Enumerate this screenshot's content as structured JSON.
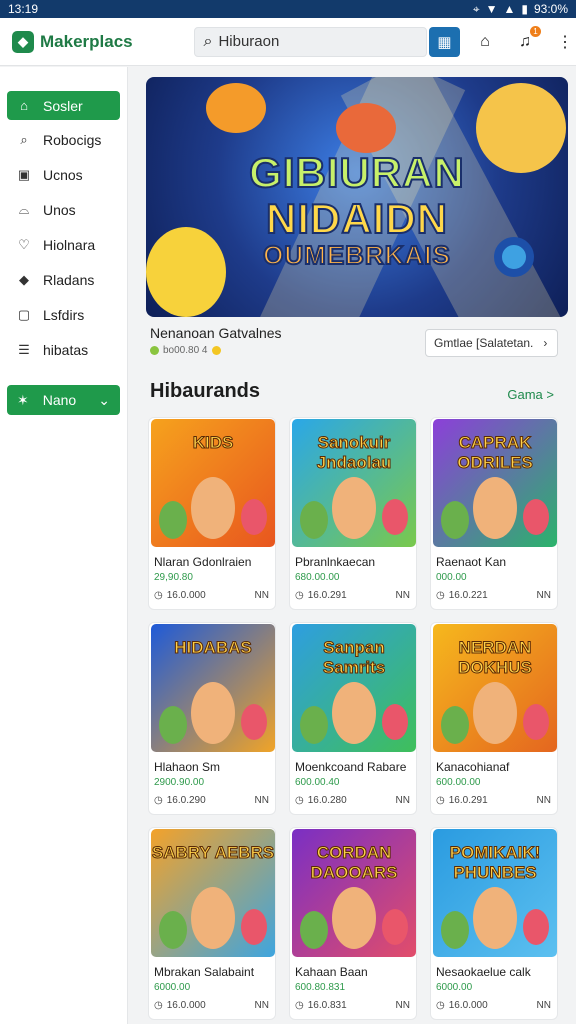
{
  "status": {
    "time": "13:19",
    "battery": "93:0%"
  },
  "app": {
    "name": "Makerplacs"
  },
  "search": {
    "value": "Hiburaon"
  },
  "notifications": {
    "count": "1"
  },
  "sidebar": {
    "items": [
      {
        "label": "Sosler",
        "icon": "home-icon"
      },
      {
        "label": "Robocigs",
        "icon": "search-icon"
      },
      {
        "label": "Ucnos",
        "icon": "image-icon"
      },
      {
        "label": "Unos",
        "icon": "bag-icon"
      },
      {
        "label": "Hiolnara",
        "icon": "heart-icon"
      },
      {
        "label": "Rladans",
        "icon": "gem-icon"
      },
      {
        "label": "Lsfdirs",
        "icon": "frame-icon"
      },
      {
        "label": "hibatas",
        "icon": "list-icon"
      }
    ],
    "cta": {
      "label": "Nano"
    }
  },
  "hero": {
    "line1": "GIBIURAN",
    "line2": "NIDAIDN",
    "line3": "OUMEBRKAIS",
    "name": "Nenanoan Gatvalnes",
    "sub": "bo00.80 4"
  },
  "select_button": {
    "label": "Gmtlae  [Salatetan."
  },
  "section": {
    "title": "Hibaurands",
    "see_all": "Gama >"
  },
  "games": [
    {
      "title": "Nlaran Gdonlraien",
      "price": "29,90.80",
      "time": "16.0.000",
      "tag": "NN",
      "art": "KIDS",
      "bg1": "#f6a21d",
      "bg2": "#e8561f"
    },
    {
      "title": "Pbranlnkaecan",
      "price": "680.00.00",
      "time": "16.0.291",
      "tag": "NN",
      "art": "Sanokuir Jndaolau",
      "bg1": "#2aa7e8",
      "bg2": "#7ac94c"
    },
    {
      "title": "Raenaot Kan",
      "price": "000.00",
      "time": "16.0.221",
      "tag": "NN",
      "art": "CAPRAK ODRILES",
      "bg1": "#8c3fd9",
      "bg2": "#2bb36b"
    },
    {
      "title": "Hlahaon Sm",
      "price": "2900.90.00",
      "time": "16.0.290",
      "tag": "NN",
      "art": "HIDABAS",
      "bg1": "#1e5ad8",
      "bg2": "#f0a428"
    },
    {
      "title": "Moenkcoand Rabare",
      "price": "600.00.40",
      "time": "16.0.280",
      "tag": "NN",
      "art": "Sanpan Samrits",
      "bg1": "#2e9ee0",
      "bg2": "#3fbf5a"
    },
    {
      "title": "Kanacohianaf",
      "price": "600.00.00",
      "time": "16.0.291",
      "tag": "NN",
      "art": "NERDAN DOKHUS",
      "bg1": "#f6b81d",
      "bg2": "#e4661f"
    },
    {
      "title": "Mbrakan Salabaint",
      "price": "6000.00",
      "time": "16.0.000",
      "tag": "NN",
      "art": "SABRY AEBRS",
      "bg1": "#f3a22a",
      "bg2": "#3ea5df"
    },
    {
      "title": "Kahaan Baan",
      "price": "600.80.831",
      "time": "16.0.831",
      "tag": "NN",
      "art": "CORDAN DAOOARS",
      "bg1": "#7a2fc4",
      "bg2": "#e24d6a"
    },
    {
      "title": "Nesaokaelue calk",
      "price": "6000.00",
      "time": "16.0.000",
      "tag": "NN",
      "art": "POMIKAIK! PHUNBES",
      "bg1": "#2a9be0",
      "bg2": "#5cc0f0"
    }
  ],
  "colors": {
    "accent": "#1f9a4b",
    "statusbar": "#123a6b",
    "search_button": "#1c6fb0"
  }
}
